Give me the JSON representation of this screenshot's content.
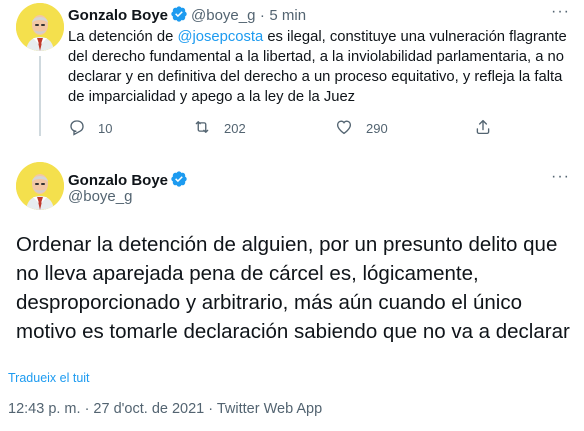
{
  "tweet1": {
    "author_name": "Gonzalo Boye",
    "handle": "@boye_g",
    "separator": "·",
    "time": "5 min",
    "text_before_mention": "La detención de ",
    "mention": "@josepcosta",
    "text_after_mention": " es ilegal, constituye una vulneración flagrante del derecho fundamental a la libertad, a la inviolabilidad parlamentaria, a no declarar y en definitiva del derecho a un proceso equitativo, y refleja la falta de imparcialidad y apego a la ley de la Juez",
    "replies": "10",
    "retweets": "202",
    "likes": "290"
  },
  "tweet2": {
    "author_name": "Gonzalo Boye",
    "handle": "@boye_g",
    "text": "Ordenar la detención de alguien, por un presunto delito que no lleva aparejada pena de cárcel es, lógicamente, desproporcionado y arbitrario, más aún cuando el único motivo es tomarle declaración sabiendo que no va a declarar",
    "translate_link": "Tradueix el tuit",
    "timestamp": "12:43 p. m. · 27 d'oct. de 2021 · Twitter Web App"
  },
  "more_label": "···",
  "colors": {
    "accent": "#1d9bf0",
    "secondary_text": "#536471",
    "avatar_bg": "#f4e04d"
  },
  "icons": [
    "verified-badge-icon",
    "more-options-icon",
    "reply-icon",
    "retweet-icon",
    "like-icon",
    "share-icon"
  ]
}
